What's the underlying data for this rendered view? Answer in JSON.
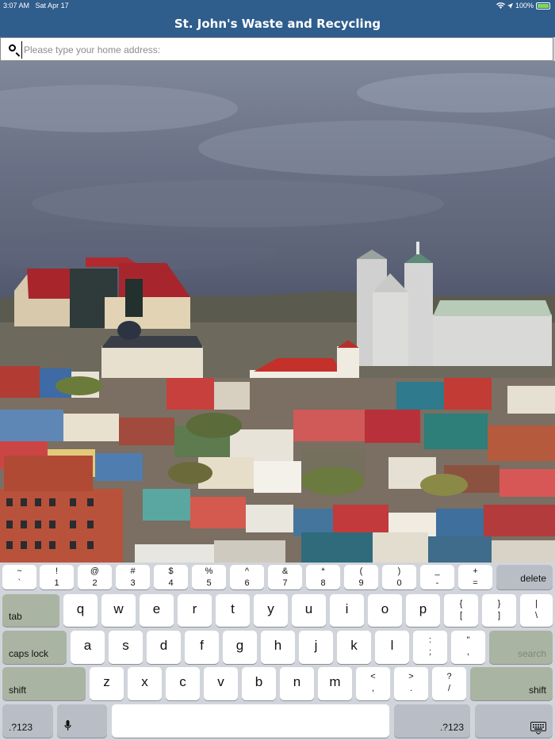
{
  "status_bar": {
    "time": "3:07 AM",
    "date": "Sat Apr 17",
    "battery": "100%"
  },
  "header": {
    "title": "St. John's Waste and Recycling"
  },
  "search": {
    "placeholder": "Please type your home address:",
    "value": ""
  },
  "keyboard": {
    "number_row": [
      {
        "top": "~",
        "bottom": "`"
      },
      {
        "top": "!",
        "bottom": "1"
      },
      {
        "top": "@",
        "bottom": "2"
      },
      {
        "top": "#",
        "bottom": "3"
      },
      {
        "top": "$",
        "bottom": "4"
      },
      {
        "top": "%",
        "bottom": "5"
      },
      {
        "top": "^",
        "bottom": "6"
      },
      {
        "top": "&",
        "bottom": "7"
      },
      {
        "top": "*",
        "bottom": "8"
      },
      {
        "top": "(",
        "bottom": "9"
      },
      {
        "top": ")",
        "bottom": "0"
      },
      {
        "top": "_",
        "bottom": "-"
      },
      {
        "top": "+",
        "bottom": "="
      }
    ],
    "delete_label": "delete",
    "tab_label": "tab",
    "row_q": [
      "q",
      "w",
      "e",
      "r",
      "t",
      "y",
      "u",
      "i",
      "o",
      "p"
    ],
    "row_q_sym": [
      {
        "top": "{",
        "bottom": "["
      },
      {
        "top": "}",
        "bottom": "]"
      },
      {
        "top": "|",
        "bottom": "\\"
      }
    ],
    "caps_label": "caps lock",
    "row_a": [
      "a",
      "s",
      "d",
      "f",
      "g",
      "h",
      "j",
      "k",
      "l"
    ],
    "row_a_sym": [
      {
        "top": ":",
        "bottom": ";"
      },
      {
        "top": "\"",
        "bottom": ","
      }
    ],
    "search_label": "search",
    "shift_label": "shift",
    "row_z": [
      "z",
      "x",
      "c",
      "v",
      "b",
      "n",
      "m"
    ],
    "row_z_sym": [
      {
        "top": "<",
        "bottom": ","
      },
      {
        "top": ">",
        "bottom": "."
      },
      {
        "top": "?",
        "bottom": "/"
      }
    ],
    "num_label": ".?123"
  }
}
